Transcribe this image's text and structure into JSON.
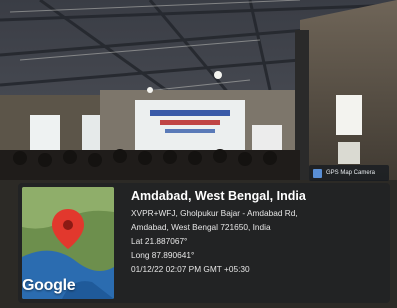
{
  "gps_badge": {
    "label": "GPS Map Camera",
    "icon": "map-pin-icon"
  },
  "map": {
    "provider_wordmark": "Google",
    "pin_color": "#e2382d"
  },
  "location": {
    "title": "Amdabad, West Bengal, India",
    "address_line_1": "XVPR+WFJ, Gholpukur Bajar - Amdabad Rd,",
    "address_line_2": "Amdabad, West Bengal 721650, India",
    "latitude": "Lat 21.887067°",
    "longitude": "Long 87.890641°",
    "timestamp": "01/12/22 02:07 PM GMT +05:30"
  },
  "colors": {
    "overlay_bg": "#202124",
    "map_water": "#2b6cb0",
    "map_land": "#6d8f4d"
  }
}
